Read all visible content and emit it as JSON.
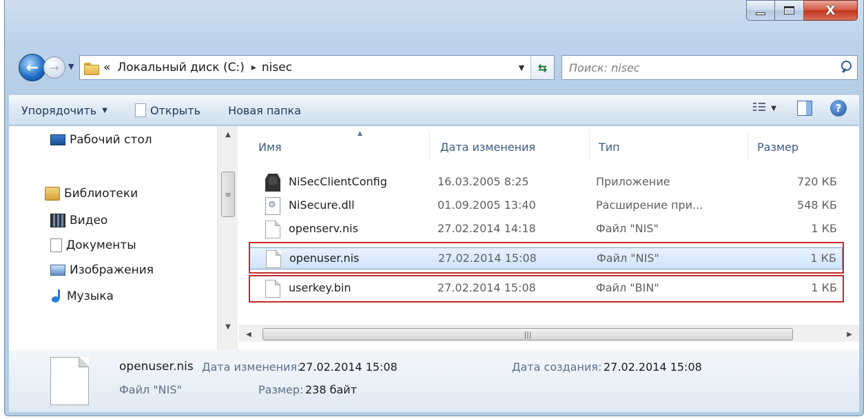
{
  "window": {
    "buttons": {
      "minimize": "minimize",
      "maximize": "maximize",
      "close": "X"
    }
  },
  "address_bar": {
    "overflow": "«",
    "crumbs": [
      "Локальный диск (C:)",
      "nisec"
    ],
    "separator": "▸"
  },
  "search": {
    "placeholder": "Поиск: nisec"
  },
  "toolbar": {
    "organize": "Упорядочить",
    "open": "Открыть",
    "new_folder": "Новая папка"
  },
  "nav_pane": {
    "items": [
      {
        "label": "Рабочий стол",
        "icon": "desktop-icon"
      },
      {
        "label": "Библиотеки",
        "icon": "libraries-icon"
      },
      {
        "label": "Видео",
        "icon": "video-icon"
      },
      {
        "label": "Документы",
        "icon": "documents-icon"
      },
      {
        "label": "Изображения",
        "icon": "pictures-icon"
      },
      {
        "label": "Музыка",
        "icon": "music-icon"
      }
    ]
  },
  "file_list": {
    "columns": [
      "Имя",
      "Дата изменения",
      "Тип",
      "Размер"
    ],
    "rows": [
      {
        "name": "NiSecClientConfig",
        "date": "16.03.2005 8:25",
        "type": "Приложение",
        "size": "720 КБ",
        "icon": "exe-icon"
      },
      {
        "name": "NiSecure.dll",
        "date": "01.09.2005 13:40",
        "type": "Расширение при...",
        "size": "548 КБ",
        "icon": "dll-icon"
      },
      {
        "name": "openserv.nis",
        "date": "27.02.2014 14:18",
        "type": "Файл \"NIS\"",
        "size": "1 КБ",
        "icon": "file-icon"
      },
      {
        "name": "openuser.nis",
        "date": "27.02.2014 15:08",
        "type": "Файл \"NIS\"",
        "size": "1 КБ",
        "icon": "file-icon"
      },
      {
        "name": "userkey.bin",
        "date": "27.02.2014 15:08",
        "type": "Файл \"BIN\"",
        "size": "1 КБ",
        "icon": "file-icon"
      }
    ],
    "selected_index": 3
  },
  "details": {
    "name": "openuser.nis",
    "type": "Файл \"NIS\"",
    "modified_label": "Дата изменения:",
    "modified_value": "27.02.2014 15:08",
    "size_label": "Размер:",
    "size_value": "238 байт",
    "created_label": "Дата создания:",
    "created_value": "27.02.2014 15:08"
  },
  "colors": {
    "highlight": "#c62828",
    "selection": "#cfe4fb"
  }
}
